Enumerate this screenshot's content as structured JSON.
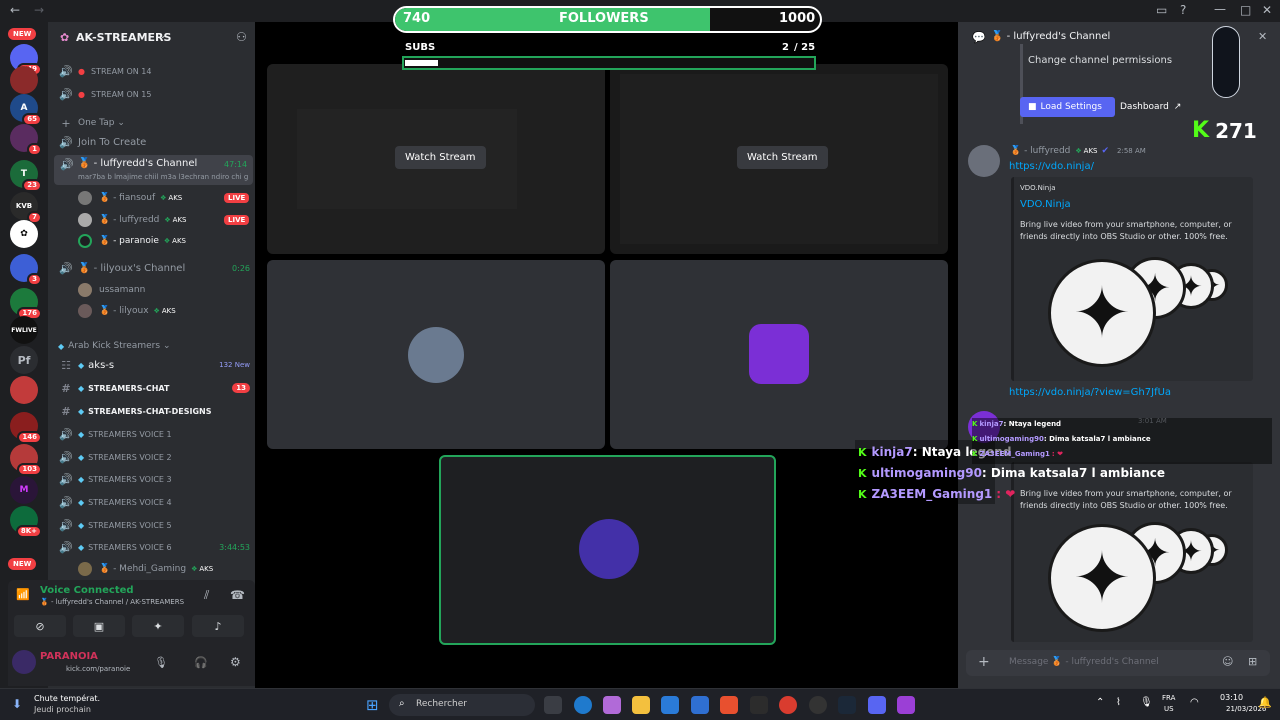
{
  "titlebar": {
    "back": "←",
    "fwd": "→"
  },
  "rail": {
    "new_top": "NEW",
    "new_bottom": "NEW",
    "badges": [
      "149",
      "",
      "65",
      "1",
      "23",
      "7",
      "",
      "3",
      "176",
      "",
      "",
      "146",
      "103",
      "",
      "8K+"
    ],
    "labels": [
      "",
      "",
      "",
      "",
      "",
      "",
      "",
      "",
      "",
      "FWLIVE",
      "Pf",
      "",
      "",
      "",
      ""
    ]
  },
  "sidebar": {
    "server_name": "AK-STREAMERS",
    "channels": [
      {
        "label": "STREAM ON 14"
      },
      {
        "label": "STREAM ON 15"
      }
    ],
    "one_tap": "One Tap",
    "join_create": "Join To Create",
    "luffy_channel": "🥉 - luffyredd's Channel",
    "luffy_time": "47:14",
    "luffy_status": "mar7ba b lmajime chiil m3a l3echran ndiro chi g...",
    "luffy_users": [
      {
        "name": "🥉 - fiansouf",
        "tag": "AKS",
        "live": "LIVE"
      },
      {
        "name": "🥉 - luffyredd",
        "tag": "AKS",
        "live": "LIVE"
      },
      {
        "name": "🥉 - paranoie",
        "tag": "AKS",
        "live": ""
      }
    ],
    "lily_channel": "🥉 - lilyoux's Channel",
    "lily_time": "0:26",
    "lily_users": [
      {
        "name": "ussamann",
        "tag": ""
      },
      {
        "name": "🥉 - lilyoux",
        "tag": "AKS"
      }
    ],
    "category": "Arab Kick Streamers",
    "text_channels": [
      {
        "label": "aks-s",
        "extra": "132 New"
      },
      {
        "label": "STREAMERS-CHAT",
        "extra": "13"
      },
      {
        "label": "STREAMERS-CHAT-designs",
        "extra": ""
      }
    ],
    "voice_channels": [
      "STREAMERS VOICE 1",
      "STREAMERS VOICE 2",
      "STREAMERS VOICE 3",
      "STREAMERS VOICE 4",
      "STREAMERS VOICE 5",
      "STREAMERS VOICE 6"
    ],
    "voice6_time": "3:44:53",
    "voice6_user": "🥉 - Mehdi_Gaming",
    "voice6_tag": "AKS"
  },
  "voice_panel": {
    "status": "Voice Connected",
    "location": "🥉 - luffyredd's Channel / AK-STREAMERS",
    "username": "PARANOIA",
    "user_sub": "kick.com/paranoie"
  },
  "stage": {
    "watch_label": "Watch Stream",
    "followers_current": "740",
    "followers_label": "FOLLOWERS",
    "followers_goal": "1000",
    "followers_progress": 0.74,
    "subs_label": "SUBS",
    "subs_current": "2",
    "subs_goal": "/ 25",
    "subs_progress": 0.08
  },
  "right": {
    "header_channel": "🥉 - luffyredd's Channel",
    "change_perms": "Change channel permissions",
    "load_settings": "Load Settings",
    "dashboard": "Dashboard",
    "kick_count": "271",
    "msg_author": "🥉 - luffyredd",
    "msg_tag": "AKS",
    "msg_time": "2:58 AM",
    "msg_link": "https://vdo.ninja/",
    "embed_provider": "VDO.Ninja",
    "embed_title": "VDO.Ninja",
    "embed_desc": "Bring live video from your smartphone, computer, or friends directly into OBS Studio or other. 100% free.",
    "msg_link2": "https://vdo.ninja/?view=Gh7JfUa",
    "msg2_time": "3:01 AM",
    "embed2_desc": "Bring live video from your smartphone, computer, or friends directly into OBS Studio or other. 100% free.",
    "composer_placeholder": "Message 🥉 - luffyredd's Channel"
  },
  "chat_overlay": {
    "lines": [
      {
        "nick": "kinja7",
        "text": ": Ntaya legend"
      },
      {
        "nick": "ultimogaming90",
        "text": ": Dima katsala7 l ambiance"
      },
      {
        "nick": "ZA3EEM_Gaming1",
        "text": ": ❤"
      }
    ]
  },
  "taskbar": {
    "weather_title": "Chute températ.",
    "weather_sub": "Jeudi prochain",
    "search_placeholder": "Rechercher",
    "lang1": "FRA",
    "lang2": "US",
    "time": "03:10",
    "date": "21/03/2026"
  }
}
